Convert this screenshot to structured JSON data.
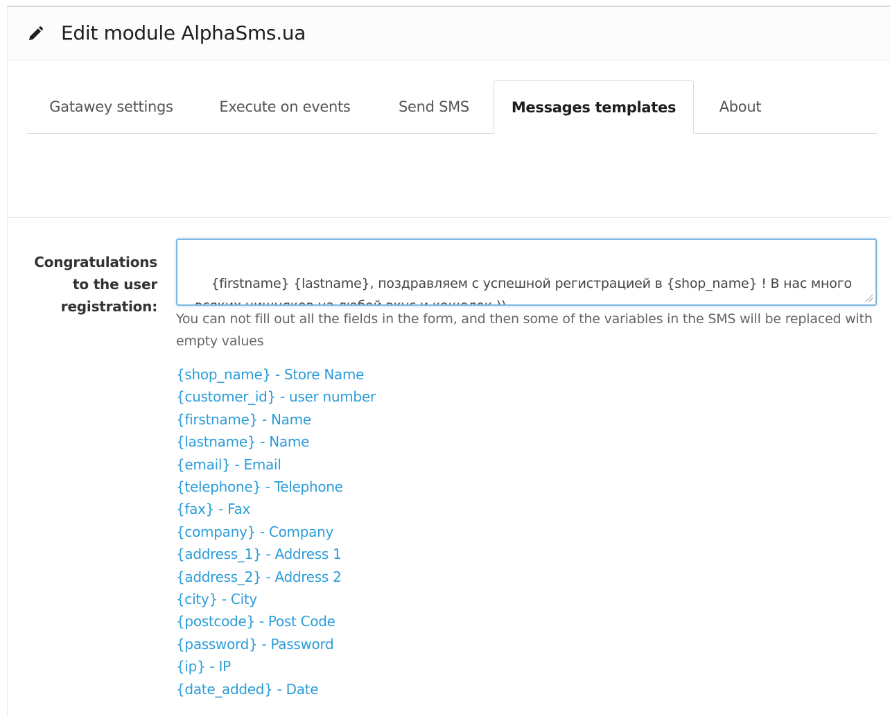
{
  "header": {
    "title": "Edit module AlphaSms.ua",
    "icon": "pencil-icon"
  },
  "tabs": [
    {
      "label": "Gatawey settings",
      "active": false
    },
    {
      "label": "Execute on events",
      "active": false
    },
    {
      "label": "Send SMS",
      "active": false
    },
    {
      "label": "Messages templates",
      "active": true
    },
    {
      "label": "About",
      "active": false
    }
  ],
  "form": {
    "field_label": "Congratulations to the user registration:",
    "field_value": "{firstname} {lastname}, поздравляем с успешной регистрацией в {shop_name} ! В нас много всяких нишняков на любой вкус и кошелек ))",
    "help_text": "You can not fill out all the fields in the form, and then some of the variables in the SMS will be replaced with empty values",
    "variables": [
      "{shop_name} - Store Name",
      "{customer_id} - user number",
      "{firstname} - Name",
      "{lastname} - Name",
      "{email} - Email",
      "{telephone} - Telephone",
      "{fax} - Fax",
      "{company} - Company",
      "{address_1} - Address 1",
      "{address_2} - Address 2",
      "{city} - City",
      "{postcode} - Post Code",
      "{password} - Password",
      "{ip} - IP",
      "{date_added} - Date"
    ]
  },
  "colors": {
    "link": "#2b9cd8",
    "focus_border": "#7eb6e0",
    "title": "#1e1e1e"
  }
}
